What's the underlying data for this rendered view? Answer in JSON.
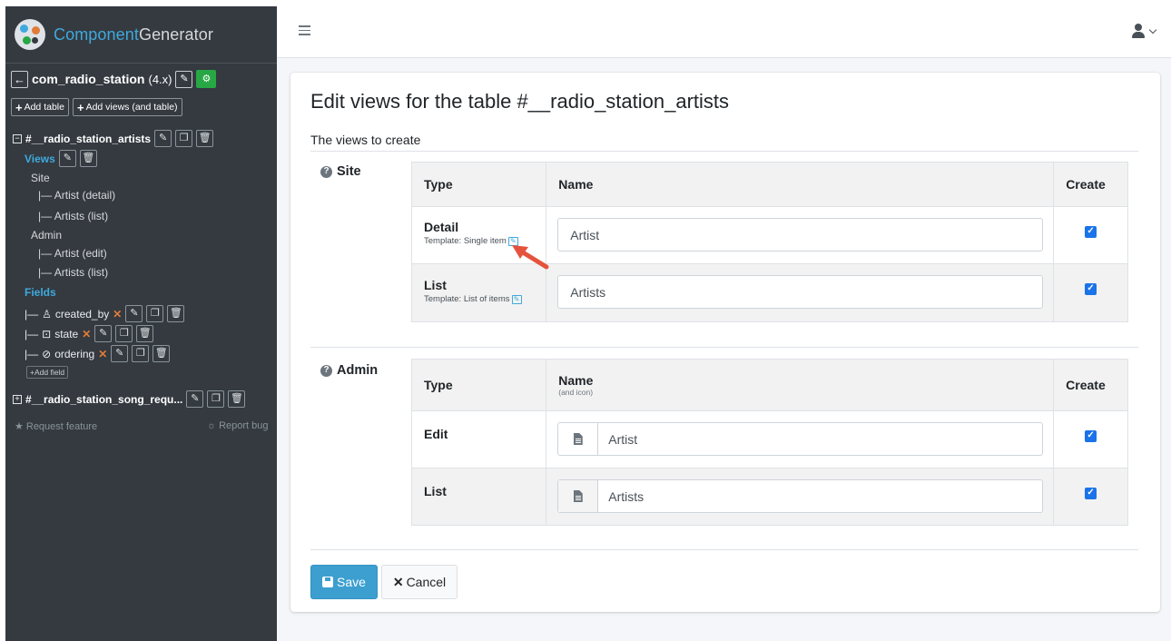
{
  "sidebar": {
    "brand_prefix": "Component",
    "brand_suffix": "Generator",
    "project_name": "com_radio_station",
    "project_version": "(4.x)",
    "add_table_label": "Add table",
    "add_views_label": "Add views (and table)",
    "table1": "#__radio_station_artists",
    "views_label": "Views",
    "site_label": "Site",
    "site_views": [
      "|— Artist (detail)",
      "|— Artists (list)"
    ],
    "admin_label": "Admin",
    "admin_views": [
      "|— Artist (edit)",
      "|— Artists (list)"
    ],
    "fields_label": "Fields",
    "fields": [
      "created_by",
      "state",
      "ordering"
    ],
    "add_field_label": "Add field",
    "table2": "#__radio_station_song_requ...",
    "request_feature": "Request feature",
    "report_bug": "Report bug"
  },
  "main": {
    "title": "Edit views for the table #__radio_station_artists",
    "subtitle": "The views to create",
    "site": {
      "label": "Site",
      "headers": {
        "type": "Type",
        "name": "Name",
        "create": "Create"
      },
      "rows": [
        {
          "type": "Detail",
          "template": "Template: Single item",
          "name": "Artist",
          "create": true
        },
        {
          "type": "List",
          "template": "Template: List of items",
          "name": "Artists",
          "create": true
        }
      ]
    },
    "admin": {
      "label": "Admin",
      "headers": {
        "type": "Type",
        "name": "Name",
        "name_sub": "(and icon)",
        "create": "Create"
      },
      "rows": [
        {
          "type": "Edit",
          "name": "Artist",
          "create": true
        },
        {
          "type": "List",
          "name": "Artists",
          "create": true
        }
      ]
    },
    "save_label": "Save",
    "cancel_label": "Cancel"
  }
}
